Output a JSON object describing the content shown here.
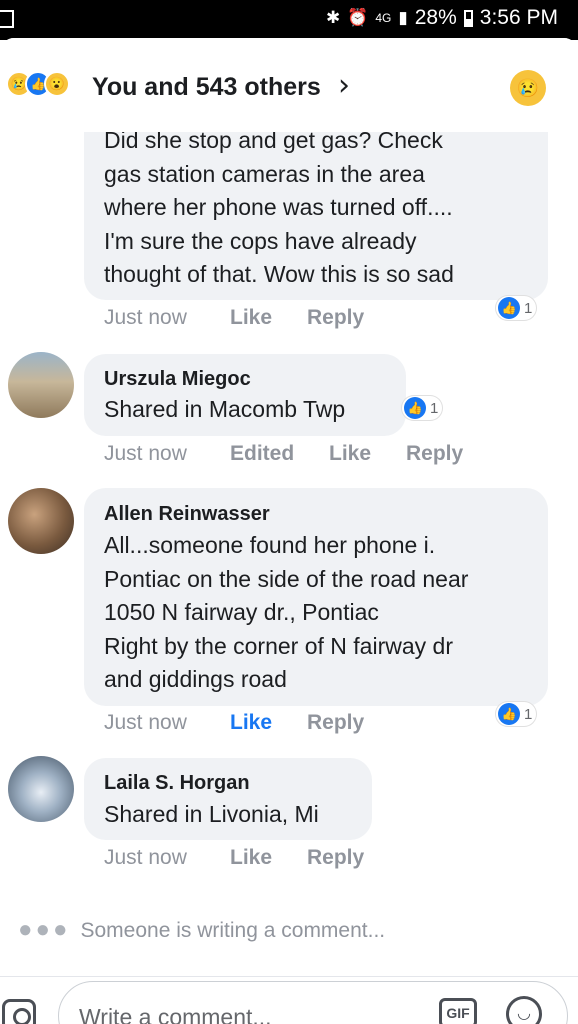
{
  "status_bar": {
    "bluetooth_icon": "bluetooth-icon",
    "alarm_icon": "alarm-icon",
    "network": "4G",
    "battery": "28%",
    "time": "3:56 PM"
  },
  "header": {
    "title": "You and 543 others",
    "reactions": [
      "sad",
      "like",
      "wow"
    ],
    "my_reaction": "sad",
    "chevron": "›"
  },
  "comments": [
    {
      "name": "",
      "text": "Did she stop and get gas? Check\ngas station cameras in the area\nwhere her phone was turned off....\nI'm sure the cops have already\nthought of that. Wow this is so sad",
      "time": "Just now",
      "actions": [
        "Like",
        "Reply"
      ],
      "liked": false,
      "like_count": "1"
    },
    {
      "name": "Urszula Miegoc",
      "text": "Shared in Macomb Twp",
      "time": "Just now",
      "actions": [
        "Edited",
        "Like",
        "Reply"
      ],
      "liked": false,
      "like_count": "1"
    },
    {
      "name": "Allen Reinwasser",
      "text": "All...someone found her phone i.\nPontiac on the side of the road near\n1050 N fairway dr., Pontiac\nRight by the corner of N fairway dr\nand giddings road",
      "time": "Just now",
      "actions": [
        "Like",
        "Reply"
      ],
      "liked": true,
      "like_count": "1"
    },
    {
      "name": "Laila S. Horgan",
      "text": "Shared in Livonia, Mi",
      "time": "Just now",
      "actions": [
        "Like",
        "Reply"
      ],
      "liked": false,
      "like_count": ""
    }
  ],
  "typing_indicator": "Someone is writing a comment...",
  "composer": {
    "placeholder": "Write a comment...",
    "gif_label": "GIF"
  },
  "colors": {
    "accent": "#1877f2",
    "bubble": "#f0f2f5",
    "meta_gray": "#90949c",
    "reaction_yellow": "#f7c33b"
  }
}
